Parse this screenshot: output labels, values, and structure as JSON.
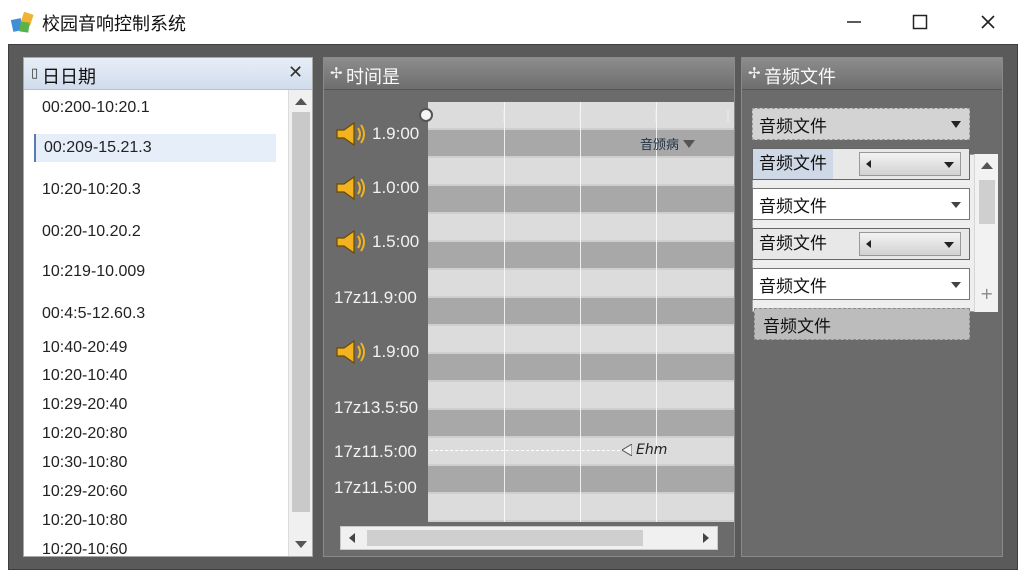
{
  "window": {
    "title": "校园音响控制系统"
  },
  "left_panel": {
    "title": "日日期",
    "items": [
      "00:200-10:20.1",
      "00:209-15.21.3",
      "10:20-10:20.3",
      "00:20-10.20.2",
      "10:219-10.009",
      "00:4:5-12.60.3",
      "10:40-20:49",
      "10:20-10:40",
      "10:29-20:40",
      "10:20-20:80",
      "10:30-10:80",
      "10:29-20:60",
      "10:20-10:80",
      "10:20-10:60"
    ],
    "selected_index": 1
  },
  "middle_panel": {
    "title": "时间昰",
    "rows": [
      {
        "time": "1.9:00",
        "speaker": true
      },
      {
        "time": "1.0:00",
        "speaker": true
      },
      {
        "time": "1.5:00",
        "speaker": true
      },
      {
        "time": "17z11.9:00",
        "speaker": false
      },
      {
        "time": "1.9:00",
        "speaker": true
      },
      {
        "time": "17z13.5:50",
        "speaker": false
      },
      {
        "time": "17z11.5:00",
        "speaker": false
      },
      {
        "time": "17z11.5:00",
        "speaker": false
      }
    ],
    "track_dropdown": "音颁病",
    "marker_label": "Ehm"
  },
  "right_panel": {
    "title": "音频文件",
    "dropdown": "音频文件",
    "list": [
      {
        "label": "音频文件",
        "type": "composite",
        "highlight": true
      },
      {
        "label": "音频文件",
        "type": "box"
      },
      {
        "label": "音频文件",
        "type": "composite",
        "highlight": false
      },
      {
        "label": "音频文件",
        "type": "box"
      }
    ],
    "bottom_item": "音频文件"
  }
}
